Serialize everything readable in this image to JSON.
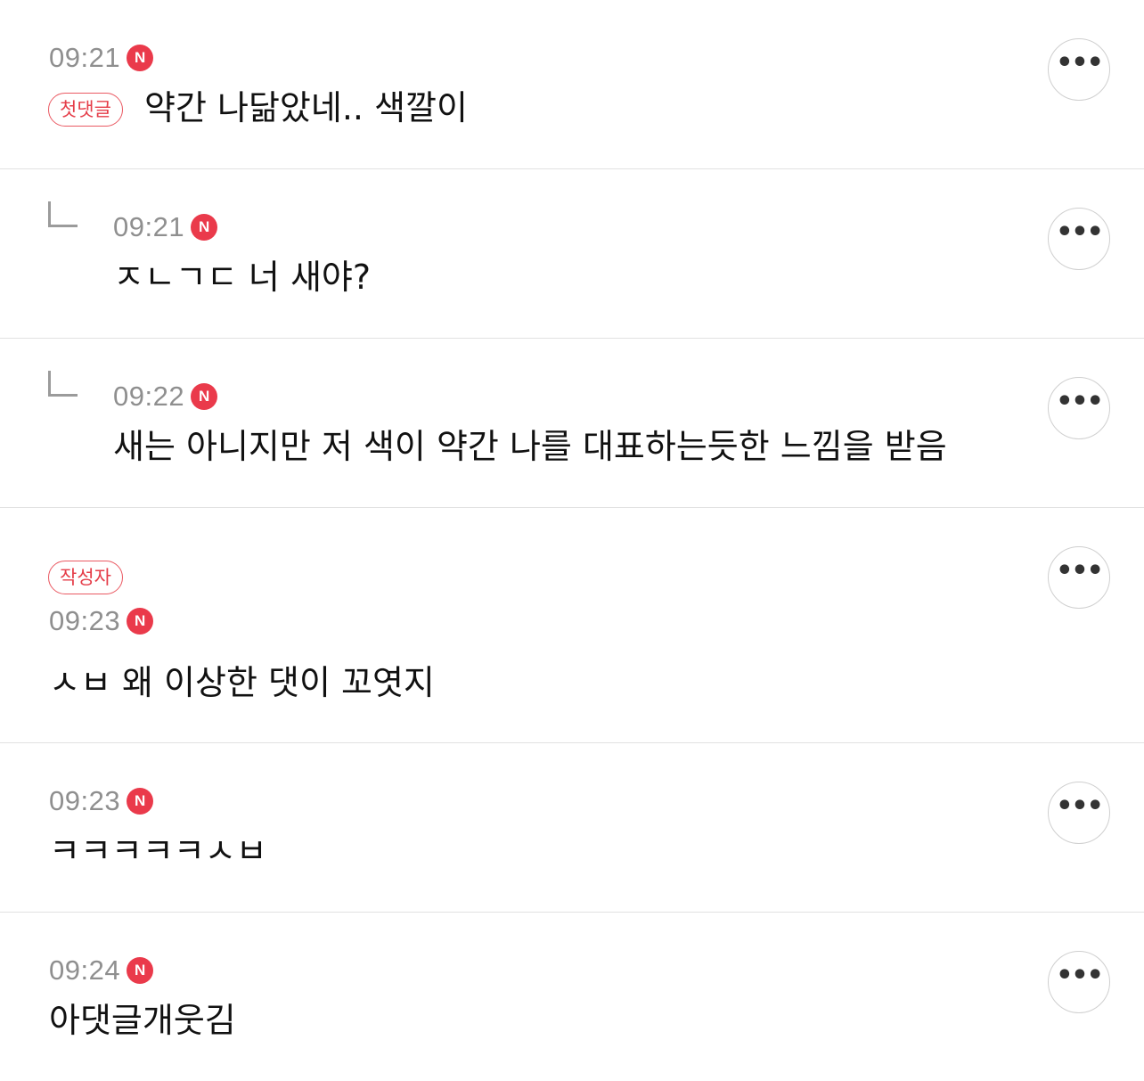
{
  "comments": [
    {
      "time": "09:21",
      "new_badge": "N",
      "tag": "첫댓글",
      "text": "약간 나닮았네.. 색깔이",
      "more": "•••"
    },
    {
      "time": "09:21",
      "new_badge": "N",
      "text": "ㅈㄴㄱㄷ 너 새야?",
      "more": "•••",
      "reply": true
    },
    {
      "time": "09:22",
      "new_badge": "N",
      "text": "새는 아니지만 저 색이 약간 나를 대표하는듯한 느낌을 받음",
      "more": "•••",
      "reply": true
    },
    {
      "time": "09:23",
      "new_badge": "N",
      "tag": "작성자",
      "text": "ㅅㅂ 왜 이상한 댓이 꼬엿지",
      "more": "•••"
    },
    {
      "time": "09:23",
      "new_badge": "N",
      "text": "ㅋㅋㅋㅋㅋㅅㅂ",
      "more": "•••"
    },
    {
      "time": "09:24",
      "new_badge": "N",
      "text": "아댓글개웃김",
      "more": "•••"
    }
  ],
  "colors": {
    "accent": "#ea3a4b",
    "time": "#8f8f8f",
    "divider": "#e1e1e1"
  }
}
